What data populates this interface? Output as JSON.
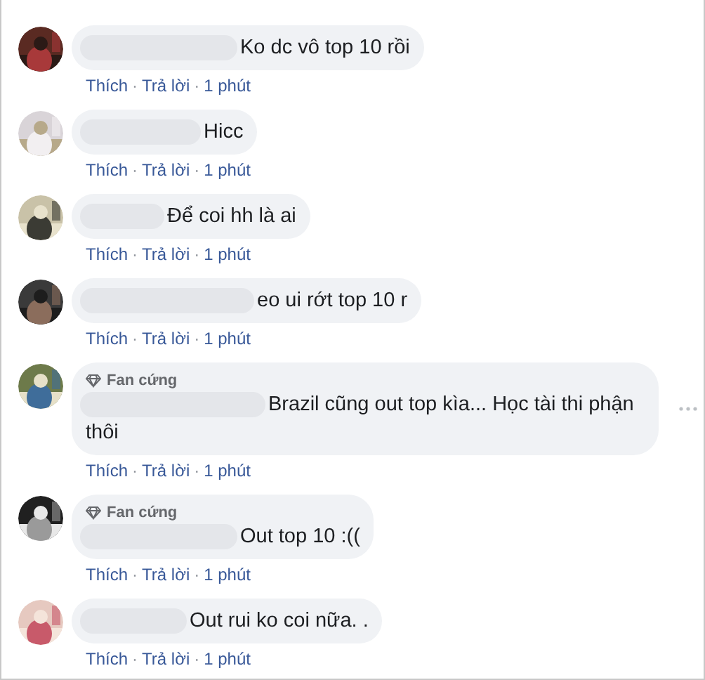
{
  "separator": "·",
  "comments": [
    {
      "text": "Ko dc vô top 10 rồi",
      "like": "Thích",
      "reply": "Trả lời",
      "time": "1 phút",
      "menu_visible": false
    },
    {
      "text": "Hicc",
      "like": "Thích",
      "reply": "Trả lời",
      "time": "1 phút",
      "menu_visible": false
    },
    {
      "text": "Để coi hh là ai",
      "like": "Thích",
      "reply": "Trả lời",
      "time": "1 phút",
      "menu_visible": false
    },
    {
      "text": "eo ui rớt top 10 r",
      "like": "Thích",
      "reply": "Trả lời",
      "time": "1 phút",
      "menu_visible": false
    },
    {
      "badge": "Fan cứng",
      "text": "Brazil cũng out top kìa... Học tài thi phận thôi",
      "like": "Thích",
      "reply": "Trả lời",
      "time": "1 phút",
      "menu_visible": true
    },
    {
      "badge": "Fan cứng",
      "text": "Out top 10 :((",
      "like": "Thích",
      "reply": "Trả lời",
      "time": "1 phút",
      "menu_visible": false
    },
    {
      "text": "Out rui ko coi nữa. .",
      "like": "Thích",
      "reply": "Trả lời",
      "time": "1 phút",
      "menu_visible": false
    }
  ]
}
